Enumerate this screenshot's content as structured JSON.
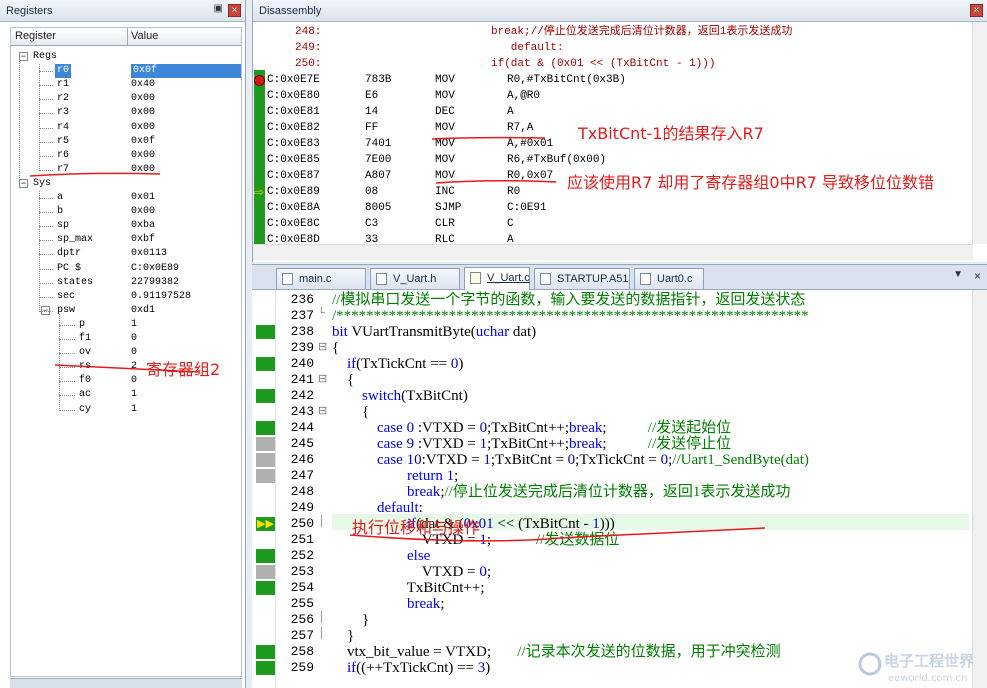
{
  "registers": {
    "title": "Registers",
    "col_register": "Register",
    "col_value": "Value",
    "groups": [
      {
        "name": "Regs",
        "items": [
          {
            "name": "r0",
            "value": "0x0f",
            "selected": true
          },
          {
            "name": "r1",
            "value": "0x40"
          },
          {
            "name": "r2",
            "value": "0x00"
          },
          {
            "name": "r3",
            "value": "0x00"
          },
          {
            "name": "r4",
            "value": "0x00"
          },
          {
            "name": "r5",
            "value": "0x0f"
          },
          {
            "name": "r6",
            "value": "0x00"
          },
          {
            "name": "r7",
            "value": "0x00"
          }
        ]
      },
      {
        "name": "Sys",
        "items": [
          {
            "name": "a",
            "value": "0x01"
          },
          {
            "name": "b",
            "value": "0x00"
          },
          {
            "name": "sp",
            "value": "0xba"
          },
          {
            "name": "sp_max",
            "value": "0xbf"
          },
          {
            "name": "dptr",
            "value": "0x0113"
          },
          {
            "name": "PC  $",
            "value": "C:0x0E89"
          },
          {
            "name": "states",
            "value": "22799382"
          },
          {
            "name": "sec",
            "value": "0.91197528"
          },
          {
            "name": "psw",
            "value": "0xd1"
          }
        ]
      },
      {
        "name": "psw_bits",
        "items": [
          {
            "name": "p",
            "value": "1"
          },
          {
            "name": "f1",
            "value": "0"
          },
          {
            "name": "ov",
            "value": "0"
          },
          {
            "name": "rs",
            "value": "2"
          },
          {
            "name": "f0",
            "value": "0"
          },
          {
            "name": "ac",
            "value": "1"
          },
          {
            "name": "cy",
            "value": "1"
          }
        ]
      }
    ]
  },
  "disassembly": {
    "title": "Disassembly",
    "source_lines": [
      {
        "num": "248:",
        "text": "break;//停止位发送完成后清位计数器，返回1表示发送成功"
      },
      {
        "num": "249:",
        "text": "   default:"
      },
      {
        "num": "250:",
        "text": "if(dat & (0x01 << (TxBitCnt - 1)))"
      }
    ],
    "asm_lines": [
      {
        "addr": "C:0x0E7E",
        "bytes": "783B",
        "op": "MOV",
        "args": "R0,#TxBitCnt(0x3B)",
        "breakpoint": true
      },
      {
        "addr": "C:0x0E80",
        "bytes": "E6",
        "op": "MOV",
        "args": "A,@R0"
      },
      {
        "addr": "C:0x0E81",
        "bytes": "14",
        "op": "DEC",
        "args": "A"
      },
      {
        "addr": "C:0x0E82",
        "bytes": "FF",
        "op": "MOV",
        "args": "R7,A"
      },
      {
        "addr": "C:0x0E83",
        "bytes": "7401",
        "op": "MOV",
        "args": "A,#0x01"
      },
      {
        "addr": "C:0x0E85",
        "bytes": "7E00",
        "op": "MOV",
        "args": "R6,#TxBuf(0x00)"
      },
      {
        "addr": "C:0x0E87",
        "bytes": "A807",
        "op": "MOV",
        "args": "R0,0x07"
      },
      {
        "addr": "C:0x0E89",
        "bytes": "08",
        "op": "INC",
        "args": "R0",
        "current": true
      },
      {
        "addr": "C:0x0E8A",
        "bytes": "8005",
        "op": "SJMP",
        "args": "C:0E91"
      },
      {
        "addr": "C:0x0E8C",
        "bytes": "C3",
        "op": "CLR",
        "args": "C"
      },
      {
        "addr": "C:0x0E8D",
        "bytes": "33",
        "op": "RLC",
        "args": "A"
      }
    ]
  },
  "editor": {
    "tabs": [
      "main.c",
      "V_Uart.h",
      "V_Uart.c",
      "STARTUP.A51",
      "Uart0.c"
    ],
    "active_tab": 2,
    "lines": [
      {
        "n": "236",
        "code": [
          [
            "cm",
            "//模拟串口发送一个字节的函数，输入要发送的数据指针，返回发送状态"
          ]
        ]
      },
      {
        "n": "237",
        "code": [
          [
            "cm",
            "/***************************************************************"
          ]
        ]
      },
      {
        "n": "238",
        "code": [
          [
            "kw",
            "bit"
          ],
          [
            "",
            " VUartTransmitByte("
          ],
          [
            "kw",
            "uchar"
          ],
          [
            "",
            " dat)"
          ]
        ]
      },
      {
        "n": "239",
        "code": [
          [
            "",
            "{"
          ]
        ]
      },
      {
        "n": "240",
        "code": [
          [
            "",
            "    "
          ],
          [
            "kw",
            "if"
          ],
          [
            "",
            "(TxTickCnt == "
          ],
          [
            "num",
            "0"
          ],
          [
            "",
            ")"
          ]
        ]
      },
      {
        "n": "241",
        "code": [
          [
            "",
            "    {"
          ]
        ]
      },
      {
        "n": "242",
        "code": [
          [
            "",
            "        "
          ],
          [
            "kw",
            "switch"
          ],
          [
            "",
            "(TxBitCnt)"
          ]
        ]
      },
      {
        "n": "243",
        "code": [
          [
            "",
            "        {"
          ]
        ]
      },
      {
        "n": "244",
        "code": [
          [
            "",
            "            "
          ],
          [
            "kw",
            "case"
          ],
          [
            "",
            " "
          ],
          [
            "num",
            "0"
          ],
          [
            "",
            " :VTXD = "
          ],
          [
            "num",
            "0"
          ],
          [
            "",
            ";TxBitCnt++;"
          ],
          [
            "kw",
            "break"
          ],
          [
            "",
            ";           "
          ],
          [
            "cm",
            "//发送起始位"
          ]
        ]
      },
      {
        "n": "245",
        "code": [
          [
            "",
            "            "
          ],
          [
            "kw",
            "case"
          ],
          [
            "",
            " "
          ],
          [
            "num",
            "9"
          ],
          [
            "",
            " :VTXD = "
          ],
          [
            "num",
            "1"
          ],
          [
            "",
            ";TxBitCnt++;"
          ],
          [
            "kw",
            "break"
          ],
          [
            "",
            ";           "
          ],
          [
            "cm",
            "//发送停止位"
          ]
        ]
      },
      {
        "n": "246",
        "code": [
          [
            "",
            "            "
          ],
          [
            "kw",
            "case"
          ],
          [
            "",
            " "
          ],
          [
            "num",
            "10"
          ],
          [
            "",
            ":VTXD = "
          ],
          [
            "num",
            "1"
          ],
          [
            "",
            ";TxBitCnt = "
          ],
          [
            "num",
            "0"
          ],
          [
            "",
            ";TxTickCnt = "
          ],
          [
            "num",
            "0"
          ],
          [
            "",
            ";"
          ],
          [
            "cm",
            "//Uart1_SendByte(dat)"
          ]
        ]
      },
      {
        "n": "247",
        "code": [
          [
            "",
            "                    "
          ],
          [
            "kw",
            "return"
          ],
          [
            "",
            " "
          ],
          [
            "num",
            "1"
          ],
          [
            "",
            ";"
          ]
        ]
      },
      {
        "n": "248",
        "code": [
          [
            "",
            "                    "
          ],
          [
            "kw",
            "break"
          ],
          [
            "",
            ";"
          ],
          [
            "cm",
            "//停止位发送完成后清位计数器，返回1表示发送成功"
          ]
        ]
      },
      {
        "n": "249",
        "code": [
          [
            "",
            "            "
          ],
          [
            "kw",
            "default"
          ],
          [
            "",
            ":"
          ]
        ]
      },
      {
        "n": "250",
        "code": [
          [
            "",
            "                    "
          ],
          [
            "kw",
            "if"
          ],
          [
            "",
            "(dat & ("
          ],
          [
            "num",
            "0x01"
          ],
          [
            "",
            " << (TxBitCnt - "
          ],
          [
            "num",
            "1"
          ],
          [
            "",
            ")))"
          ]
        ]
      },
      {
        "n": "251",
        "code": [
          [
            "",
            "                        VTXD = "
          ],
          [
            "num",
            "1"
          ],
          [
            "",
            ";            "
          ],
          [
            "cm",
            "//发送数据位"
          ]
        ]
      },
      {
        "n": "252",
        "code": [
          [
            "",
            "                    "
          ],
          [
            "kw",
            "else"
          ]
        ]
      },
      {
        "n": "253",
        "code": [
          [
            "",
            "                        VTXD = "
          ],
          [
            "num",
            "0"
          ],
          [
            "",
            ";"
          ]
        ]
      },
      {
        "n": "254",
        "code": [
          [
            "",
            "                    TxBitCnt++;"
          ]
        ]
      },
      {
        "n": "255",
        "code": [
          [
            "",
            "                    "
          ],
          [
            "kw",
            "break"
          ],
          [
            "",
            ";"
          ]
        ]
      },
      {
        "n": "256",
        "code": [
          [
            "",
            "        }"
          ]
        ]
      },
      {
        "n": "257",
        "code": [
          [
            "",
            "    }"
          ]
        ]
      },
      {
        "n": "258",
        "code": [
          [
            "",
            "    vtx_bit_value = VTXD;       "
          ],
          [
            "cm",
            "//记录本次发送的位数据，用于冲突检测"
          ]
        ]
      },
      {
        "n": "259",
        "code": [
          [
            "",
            "    "
          ],
          [
            "kw",
            "if"
          ],
          [
            "",
            "((++TxTickCnt) == "
          ],
          [
            "num",
            "3"
          ],
          [
            "",
            ")"
          ]
        ]
      }
    ]
  },
  "annotations": {
    "mov_r7": "TxBitCnt-1的结果存入R7",
    "wrong_bank": "应该使用R7 却用了寄存器组0中R7 导致移位位数错",
    "bank2": "寄存器组2",
    "shift_and": "执行位移和与操作"
  },
  "watermark": {
    "line1": "电子工程世界",
    "line2": "eeworld.com.cn"
  },
  "colors": {
    "annotation": "#e61b1b",
    "keyword": "#0000ff",
    "comment": "#007f00",
    "coverage_green": "#1e9a1e",
    "selection": "#3d86d8"
  }
}
